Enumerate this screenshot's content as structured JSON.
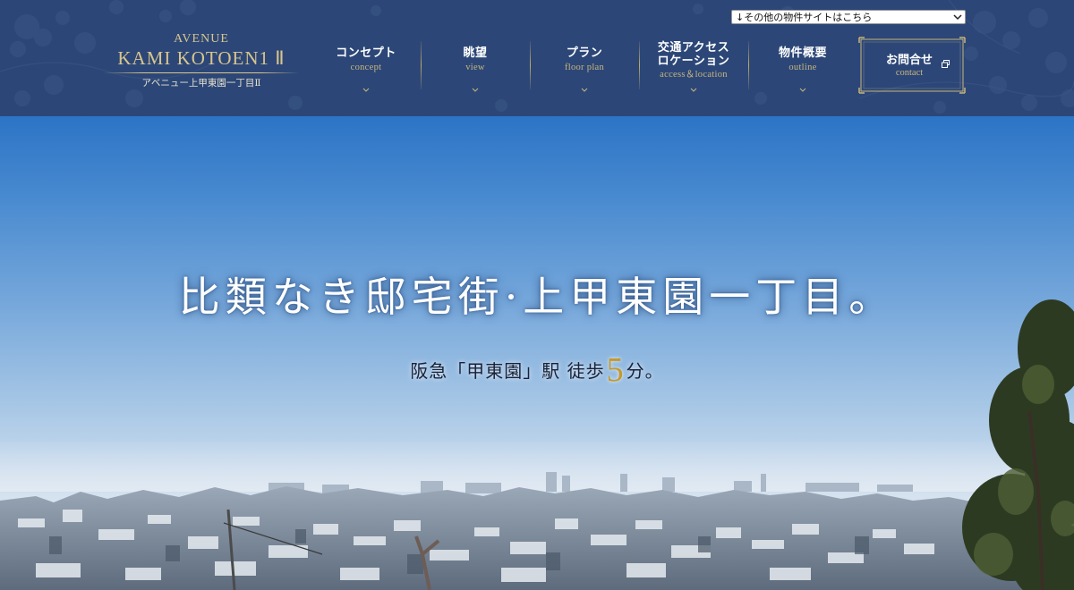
{
  "header": {
    "brand": {
      "top": "AVENUE",
      "main": "KAMI KOTOEN1 Ⅱ",
      "sub": "アベニュー上甲東園一丁目Ⅱ"
    },
    "other_sites_select": {
      "selected": "↓その他の物件サイトはこちら"
    },
    "nav": [
      {
        "jp": "コンセプト",
        "en": "concept"
      },
      {
        "jp": "眺望",
        "en": "view"
      },
      {
        "jp": "プラン",
        "en": "floor plan"
      },
      {
        "jp": "交通アクセス\nロケーション",
        "jp_line1": "交通アクセス",
        "jp_line2": "ロケーション",
        "en": "access＆location"
      },
      {
        "jp": "物件概要",
        "en": "outline"
      }
    ],
    "contact": {
      "jp": "お問合せ",
      "en": "contact"
    }
  },
  "hero": {
    "headline": "比類なき邸宅街·上甲東園一丁目。",
    "subline_before": "阪急「甲東園」駅 徒歩",
    "subline_number": "5",
    "subline_after": "分。"
  },
  "colors": {
    "header_bg": "#2c4777",
    "gold": "#d8c58e",
    "sky_top": "#2c74c6"
  },
  "icons": [
    "chevron-down-icon",
    "external-window-icon",
    "select-arrow-icon"
  ]
}
